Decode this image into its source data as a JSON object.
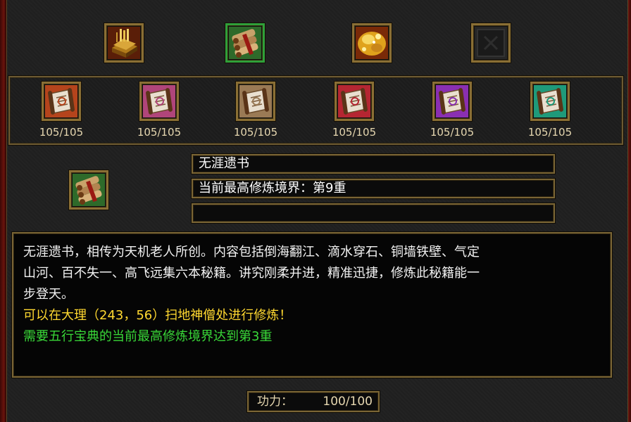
{
  "top_icons": [
    {
      "icon": "golden-book-icon",
      "frame_color": "#8a6f35"
    },
    {
      "icon": "scroll-bundle-icon",
      "frame_color": "#2fa03a"
    },
    {
      "icon": "treasure-chest-icon",
      "frame_color": "#8a6f35"
    },
    {
      "icon": "empty-slot-icon",
      "frame_color": "#8a6f35"
    }
  ],
  "scrolls": [
    {
      "icon": "red-scroll-icon",
      "color": "#b5441c",
      "count": "105/105"
    },
    {
      "icon": "pink-scroll-icon",
      "color": "#b0457a",
      "count": "105/105"
    },
    {
      "icon": "tan-scroll-icon",
      "color": "#9a7a55",
      "count": "105/105"
    },
    {
      "icon": "crimson-scroll-icon",
      "color": "#b52632",
      "count": "105/105"
    },
    {
      "icon": "purple-scroll-icon",
      "color": "#8a2fb2",
      "count": "105/105"
    },
    {
      "icon": "teal-scroll-icon",
      "color": "#1f9a7a",
      "count": "105/105"
    }
  ],
  "selected": {
    "icon": "scroll-bundle-icon",
    "name": "无涯遗书",
    "realm": "当前最高修炼境界：第9重",
    "extra": ""
  },
  "description": {
    "lines": [
      "无涯遗书，相传为天机老人所创。内容包括倒海翻江、滴水穿石、铜墙铁壁、气定",
      "山河、百不失一、高飞远集六本秘籍。讲究刚柔并进，精准迅捷，修炼此秘籍能一",
      "步登天。"
    ],
    "location": "可以在大理（243，56）扫地神僧处进行修炼！",
    "requirement": "需要五行宝典的当前最高修炼境界达到第3重"
  },
  "power": {
    "label": "功力：",
    "value": "100/100"
  },
  "colors": {
    "text_yellow": "#ffd830",
    "text_green": "#39d838",
    "frame_gold": "#7a6535"
  }
}
